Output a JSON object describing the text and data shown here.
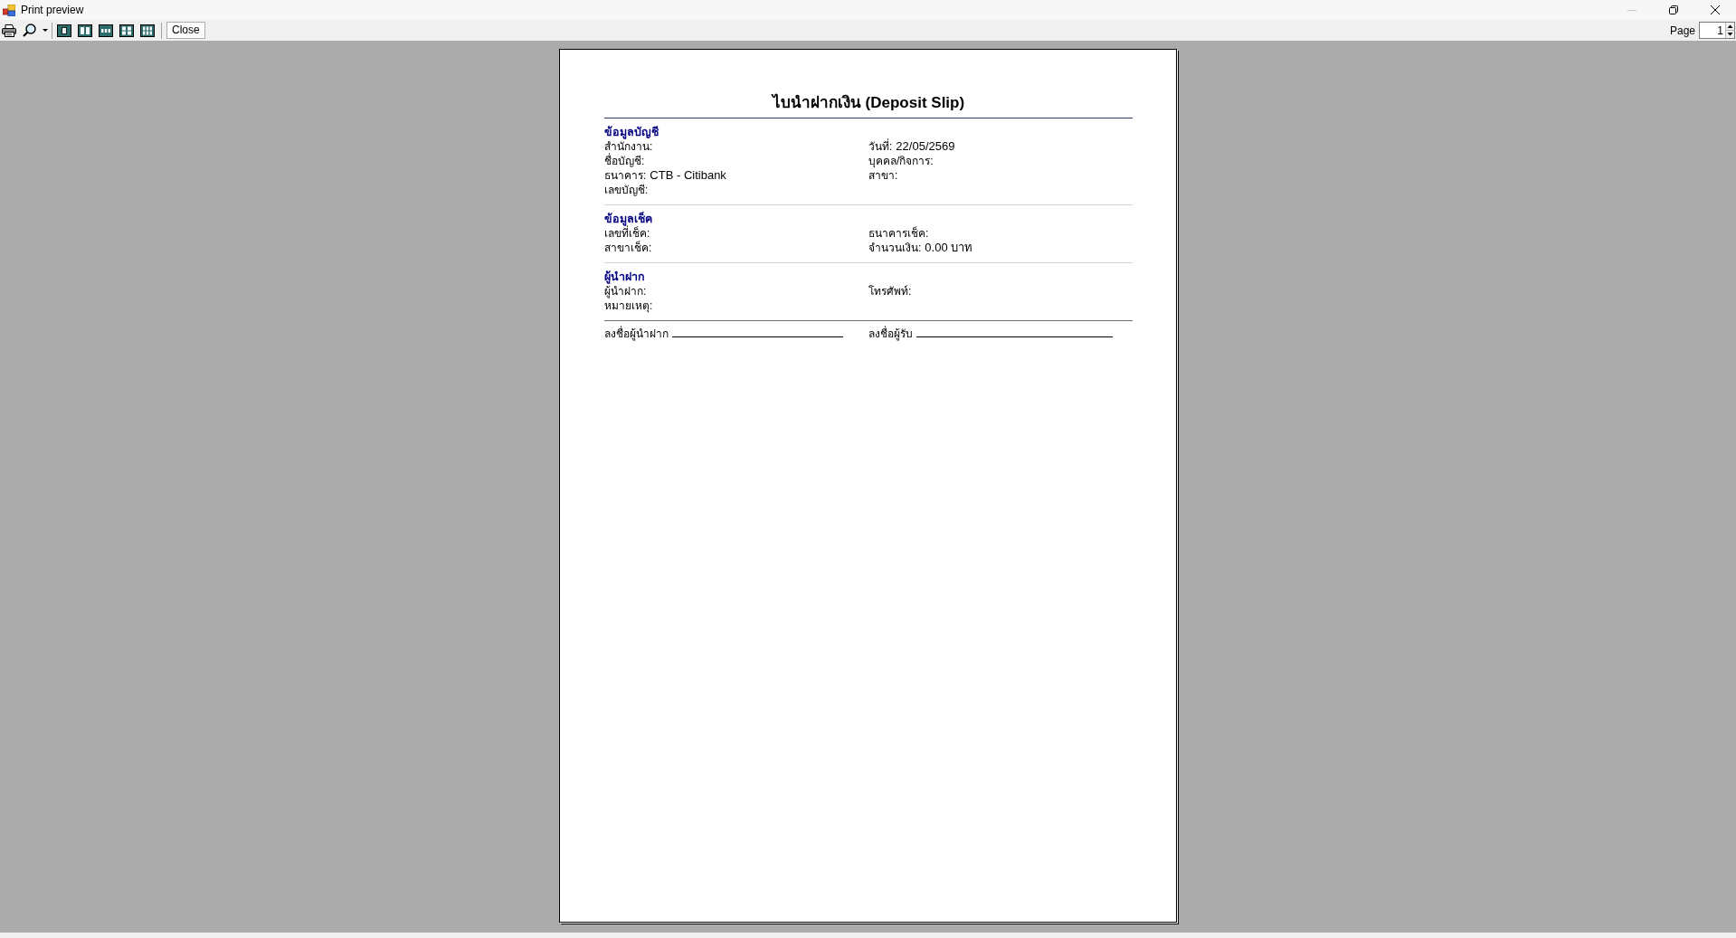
{
  "window": {
    "title": "Print preview",
    "minimize_disabled": true
  },
  "toolbar": {
    "close_button": "Close",
    "page_label": "Page",
    "page_number": "1"
  },
  "document": {
    "title": "ไบนำฝากเงิน (Deposit Slip)",
    "sections": [
      {
        "heading": "ข้อมูลบัญชี",
        "fields": [
          {
            "label": "สำนักงาน:"
          },
          {
            "label": "วันที่:",
            "value": "22/05/2569"
          },
          {
            "label": "ชื่อบัญชี:"
          },
          {
            "label": "บุคคล/กิจการ:"
          },
          {
            "label": "ธนาคาร:",
            "value": "CTB - Citibank"
          },
          {
            "label": "สาขา:"
          },
          {
            "label": "เลขบัญชี:"
          }
        ]
      },
      {
        "heading": "ข้อมูลเช็ค",
        "fields": [
          {
            "label": "เลขที่เช็ค:"
          },
          {
            "label": "ธนาคารเช็ค:"
          },
          {
            "label": "สาขาเช็ค:"
          },
          {
            "label": "จำนวนเงิน:",
            "value": "0.00 บาท"
          }
        ]
      },
      {
        "heading": "ผู้นำฝาก",
        "fields": [
          {
            "label": "ผู้นำฝาก:"
          },
          {
            "label": "โทรศัพท์:"
          },
          {
            "label": "หมายเหตุ:"
          }
        ]
      }
    ],
    "signatures": [
      {
        "label": "ลงชื่อผู้นำฝาก"
      },
      {
        "label": "ลงชื่อผู้รับ"
      }
    ]
  }
}
